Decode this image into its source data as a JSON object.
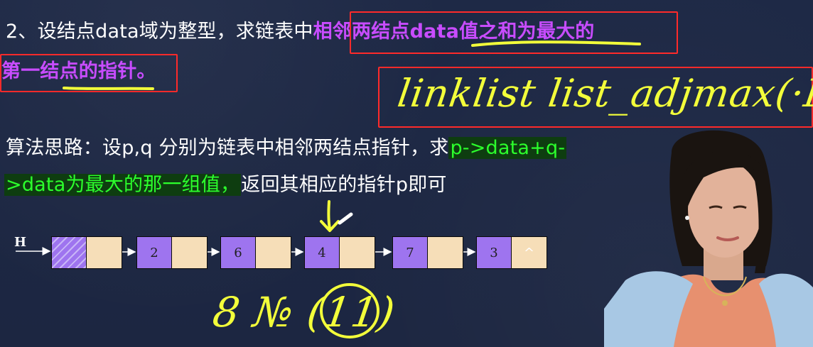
{
  "question": {
    "line1_prefix": "2、设结点data域为整型，求链表中",
    "line1_highlight": "相邻两结点data值之和为最大的",
    "line2_highlight": "第一结点的指针。"
  },
  "handwriting": {
    "signature": "linklist list_adjmax(·H)",
    "note": "8 № (11)"
  },
  "algorithm": {
    "line1_prefix": "算法思路：设p,q 分别为链表中相邻两结点指针，求",
    "line1_highlight": "p->data+q-",
    "line2_highlight": ">data为最大的那一组值，",
    "line2_suffix": "返回其相应的指针p即可"
  },
  "linked_list": {
    "head_label": "H",
    "nodes": [
      {
        "data": ""
      },
      {
        "data": "2"
      },
      {
        "data": "6"
      },
      {
        "data": "4"
      },
      {
        "data": "7"
      },
      {
        "data": "3"
      }
    ],
    "null_symbol": "^"
  },
  "colors": {
    "background": "#1f2a45",
    "highlight_purple": "#c84cff",
    "highlight_green": "#2cff2c",
    "box_red": "#ff2a2a",
    "ink_yellow": "#f3ff3a",
    "node_data": "#9e74ef",
    "node_next": "#f6deb8"
  }
}
